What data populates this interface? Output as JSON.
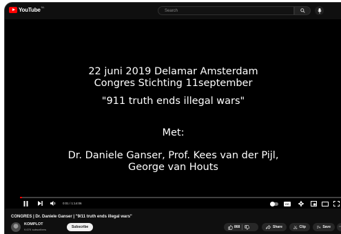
{
  "header": {
    "logo_text": "YouTube",
    "logo_sup": "NL",
    "search_placeholder": "Search"
  },
  "video_overlay": {
    "line1": "22 juni 2019 Delamar Amsterdam",
    "line2": "Congres Stichting 11september",
    "line3": "\"911 truth ends illegal wars\"",
    "line4": "Met:",
    "line5": "Dr. Daniele Ganser, Prof. Kees van der Pijl,",
    "line6": "George van Houts"
  },
  "player": {
    "time_display": "0:01 / 1:14:06",
    "progress_fraction": 0.0002,
    "cc_label": "CC"
  },
  "video": {
    "title": "CONGRES | Dr. Daniele Ganser | \"9/11 truth ends illegal wars\"",
    "channel_name": "KOMPLOT",
    "subscribers": "9.67K subscribers",
    "subscribe_label": "Subscribe",
    "like_count": "868",
    "share_label": "Share",
    "clip_label": "Clip",
    "save_label": "Save",
    "more_label": "···"
  },
  "colors": {
    "accent": "#ff0000",
    "background": "#0f0f0f"
  }
}
